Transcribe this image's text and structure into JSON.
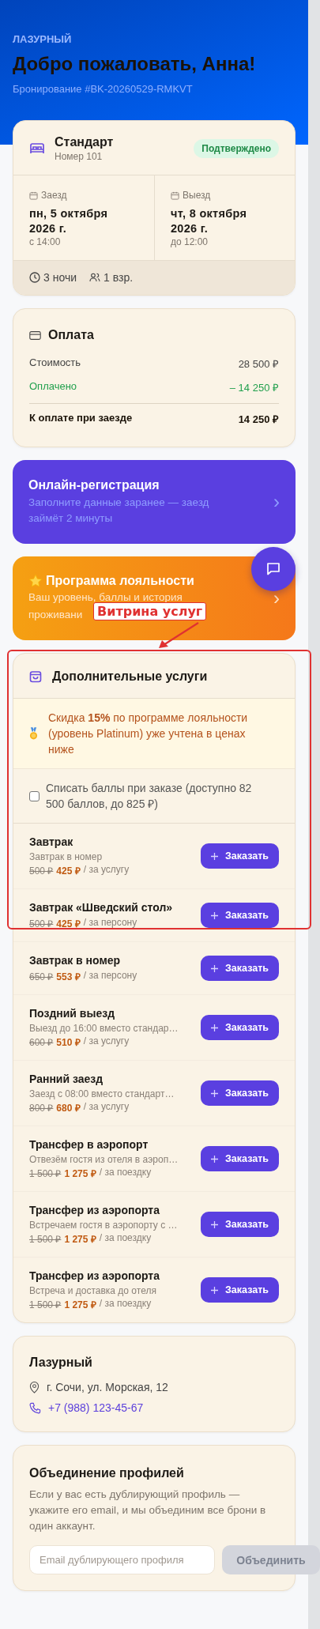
{
  "header": {
    "brand": "ЛАЗУРНЫЙ",
    "title": "Добро пожаловать, Анна!",
    "booking": "Бронирование #BK-20260529-RMKVT"
  },
  "room": {
    "name": "Стандарт",
    "number": "Номер 101",
    "status": "Подтверждено",
    "dates": [
      {
        "label": "Заезд",
        "date": "пн, 5 октября 2026 г.",
        "time": "с 14:00"
      },
      {
        "label": "Выезд",
        "date": "чт, 8 октября 2026 г.",
        "time": "до 12:00"
      }
    ],
    "nights": "3 ночи",
    "guests": "1 взр."
  },
  "payment": {
    "title": "Оплата",
    "rows": [
      {
        "kind": "plain",
        "label": "Стоимость",
        "value": "28 500 ₽"
      },
      {
        "kind": "paid",
        "label": "Оплачено",
        "value": "– 14 250 ₽"
      },
      {
        "kind": "total",
        "label": "К оплате при заезде",
        "value": "14 250 ₽"
      }
    ]
  },
  "checkin": {
    "title": "Онлайн-регистрация",
    "subtitle": "Заполните данные заранее — заезд займёт 2 минуты",
    "chevron": "›"
  },
  "loyalty": {
    "title": "Программа лояльности",
    "subtitle_lines": [
      "Ваш уровень, баллы и история",
      "проживани"
    ],
    "chevron": "›"
  },
  "annotation": {
    "label": "Витрина услуг"
  },
  "services": {
    "title": "Дополнительные услуги",
    "discount": "Скидка **15%** по программе лояльности (уровень Platinum) уже учтена в ценах ниже",
    "points": {
      "label": "Списать баллы при заказе (доступно 82 500 баллов, до 825 ₽)",
      "checked": false
    },
    "items": [
      {
        "name": "Завтрак",
        "description": "Завтрак в номер",
        "old_price": "500 ₽",
        "price": "425 ₽",
        "unit": "/ за услугу",
        "button": "Заказать"
      },
      {
        "name": "Завтрак «Шведский стол»",
        "old_price": "500 ₽",
        "price": "425 ₽",
        "unit": "/ за персону",
        "button": "Заказать"
      },
      {
        "name": "Завтрак в номер",
        "old_price": "650 ₽",
        "price": "553 ₽",
        "unit": "/ за персону",
        "button": "Заказать"
      },
      {
        "name": "Поздний выезд",
        "description": "Выезд до 16:00 вместо стандар…",
        "old_price": "600 ₽",
        "price": "510 ₽",
        "unit": "/ за услугу",
        "button": "Заказать"
      },
      {
        "name": "Ранний заезд",
        "description": "Заезд с 08:00 вместо стандарт…",
        "old_price": "800 ₽",
        "price": "680 ₽",
        "unit": "/ за услугу",
        "button": "Заказать"
      },
      {
        "name": "Трансфер в аэропорт",
        "description": "Отвезём гостя из отеля в аэроп…",
        "old_price": "1 500 ₽",
        "price": "1 275 ₽",
        "unit": "/ за поездку",
        "button": "Заказать"
      },
      {
        "name": "Трансфер из аэропорта",
        "description": "Встречаем гостя в аэропорту с …",
        "old_price": "1 500 ₽",
        "price": "1 275 ₽",
        "unit": "/ за поездку",
        "button": "Заказать"
      },
      {
        "name": "Трансфер из аэропорта",
        "description": "Встреча и доставка до отеля",
        "old_price": "1 500 ₽",
        "price": "1 275 ₽",
        "unit": "/ за поездку",
        "button": "Заказать"
      }
    ]
  },
  "hotel": {
    "name": "Лазурный",
    "address": "г. Сочи, ул. Морская, 12",
    "phone": "+7 (988) 123-45-67"
  },
  "merge": {
    "title": "Объединение профилей",
    "text": "Если у вас есть дублирующий профиль — укажите его email, и мы объединим все брони в один аккаунт.",
    "placeholder": "Email дублирующего профиля",
    "button": "Объединить",
    "disabled": true
  }
}
